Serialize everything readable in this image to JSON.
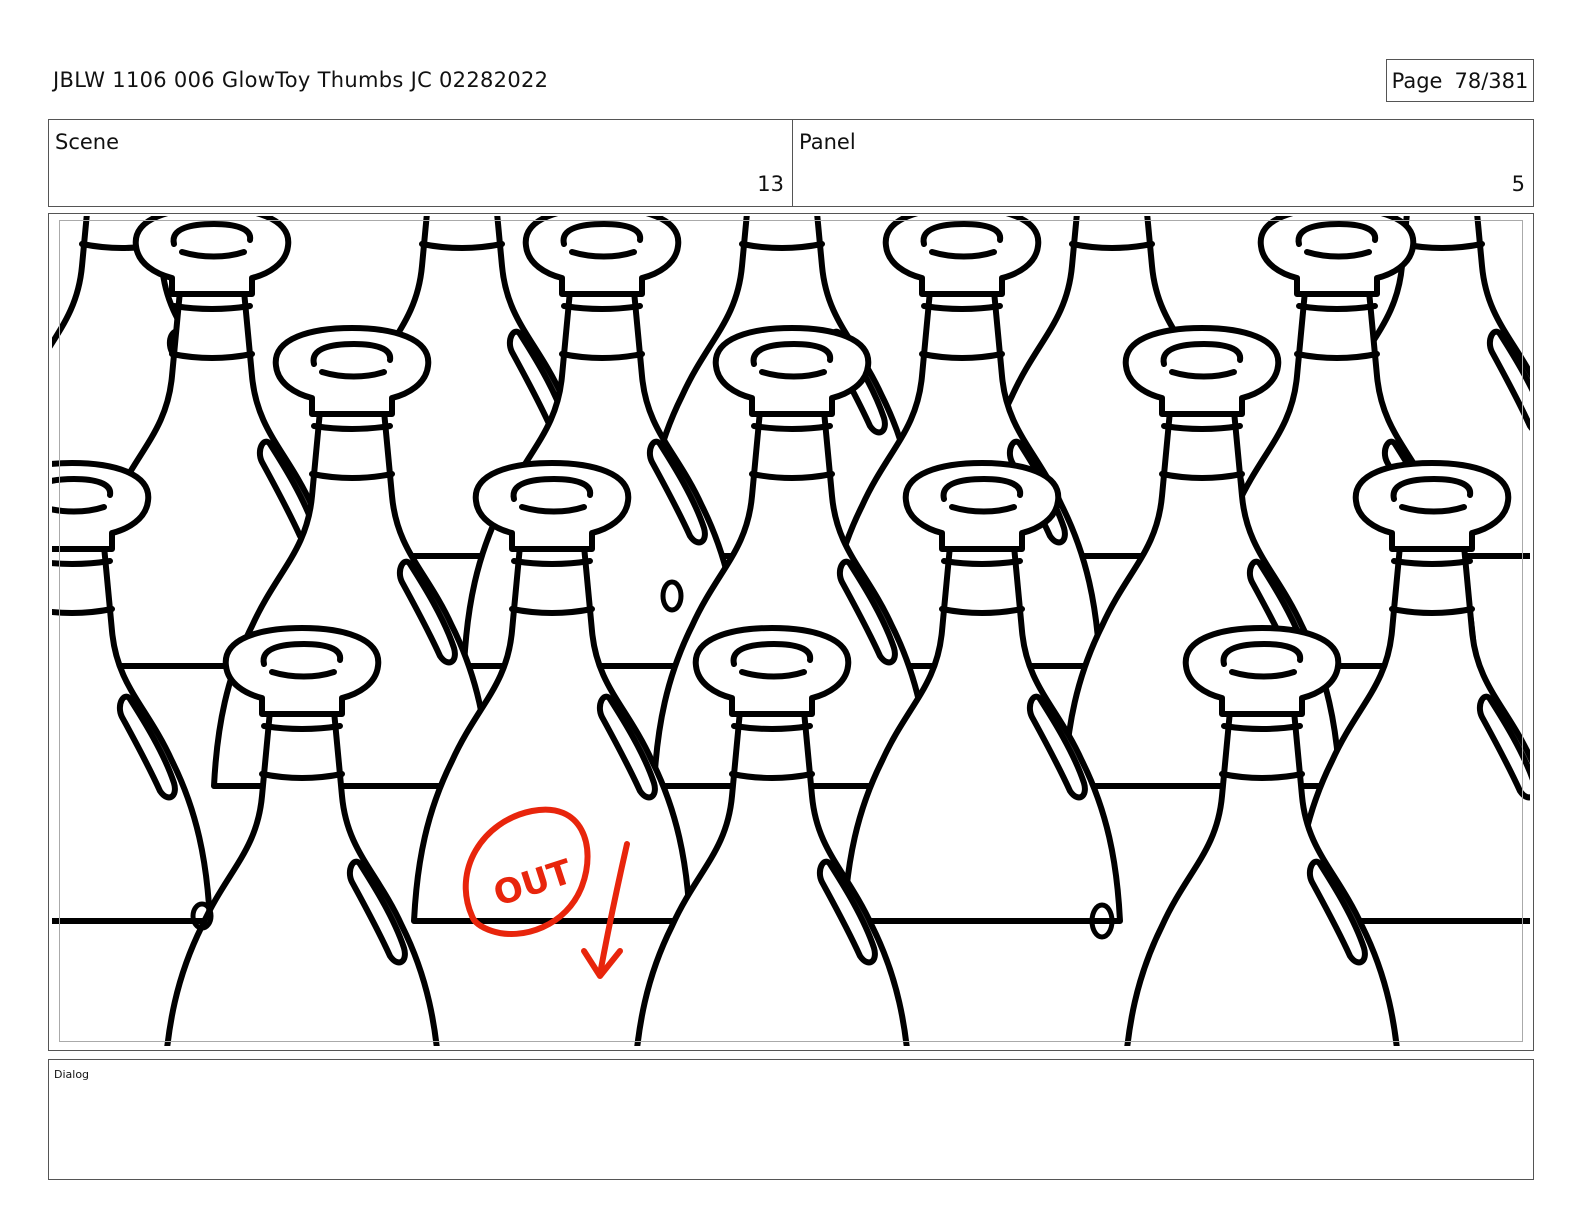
{
  "header": {
    "title": "JBLW 1106 006 GlowToy Thumbs JC 02282022",
    "page_label": "Page",
    "page_number": "78/381"
  },
  "scene": {
    "label": "Scene",
    "value": "13"
  },
  "panel": {
    "label": "Panel",
    "value": "5"
  },
  "drawing": {
    "annotation_text": "OUT",
    "annotation_color": "#e8250c",
    "line_color": "#000000"
  },
  "dialog": {
    "label": "Dialog",
    "text": ""
  }
}
